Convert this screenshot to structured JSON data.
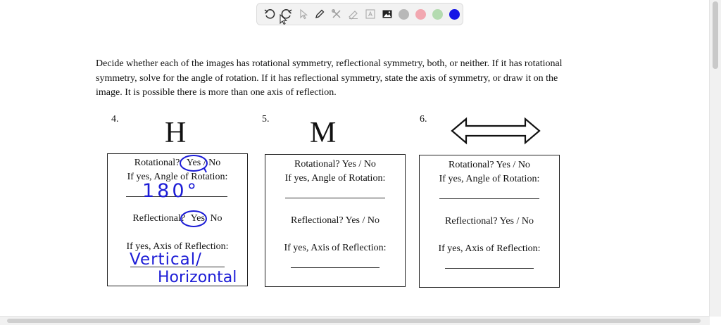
{
  "toolbar": {
    "tools": [
      {
        "name": "undo-icon"
      },
      {
        "name": "redo-icon"
      },
      {
        "name": "pointer-icon"
      },
      {
        "name": "pencil-icon"
      },
      {
        "name": "tools-icon"
      },
      {
        "name": "highlighter-icon"
      },
      {
        "name": "text-icon"
      },
      {
        "name": "image-icon"
      }
    ],
    "colors": [
      "#b8b8b8",
      "#f2a7b0",
      "#b4dbb0",
      "#1414e6"
    ]
  },
  "worksheet": {
    "instructions": "Decide whether each of the images has rotational symmetry, reflectional symmetry, both, or neither. If it has rotational symmetry, solve for the angle of rotation. If it has reflectional symmetry, state the axis of symmetry, or draw it on the image. It is possible there is more than one axis of reflection.",
    "problems": [
      {
        "number": "4.",
        "figure": "H",
        "rotational_q": "Rotational?",
        "yes": "Yes",
        "sep": "/",
        "no": "No",
        "angle_label": "If yes, Angle of Rotation:",
        "reflectional_q": "Reflectional?",
        "axis_label": "If yes, Axis of Reflection:"
      },
      {
        "number": "5.",
        "figure": "M",
        "rotational_line": "Rotational?  Yes / No",
        "angle_label": "If yes, Angle of Rotation:",
        "reflectional_line": "Reflectional? Yes / No",
        "axis_label": "If yes, Axis of Reflection:"
      },
      {
        "number": "6.",
        "figure": "",
        "rotational_line": "Rotational?  Yes / No",
        "angle_label": "If yes, Angle of Rotation:",
        "reflectional_line": "Reflectional? Yes / No",
        "axis_label": "If yes, Axis of Reflection:"
      }
    ]
  },
  "annotations": {
    "ink_color": "#1c1cd6",
    "angle_answer": "180°",
    "axis_answer_line1": "Vertical/",
    "axis_answer_line2": "Horizontal"
  }
}
